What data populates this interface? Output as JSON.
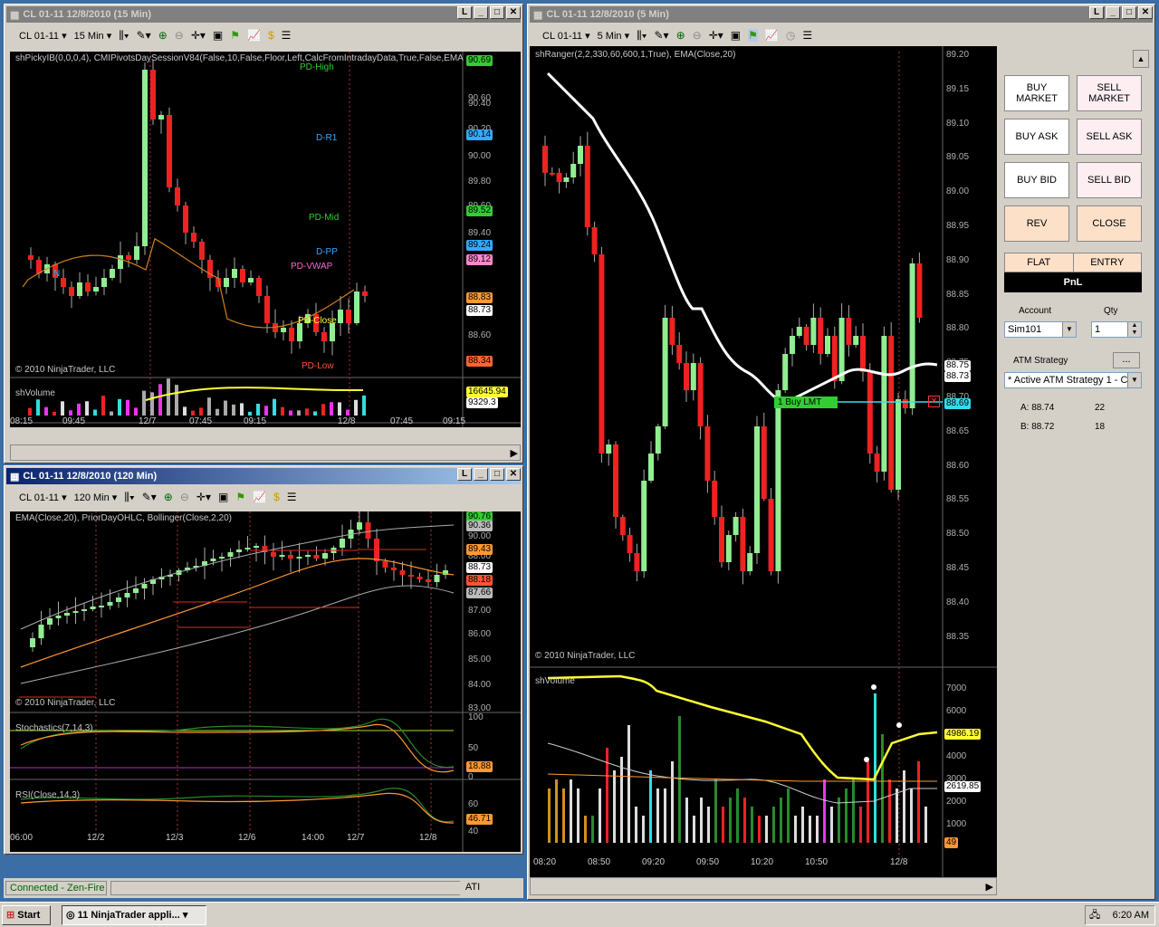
{
  "status_bar": {
    "connection": "Connected - Zen-Fire",
    "ati": "ATI"
  },
  "taskbar": {
    "start": "Start",
    "task": "11 NinjaTrader appli...",
    "time": "6:20 AM"
  },
  "win15": {
    "title": "CL 01-11  12/8/2010 (15 Min)",
    "instrument": "CL 01-11",
    "interval": "15 Min",
    "indicator_title": "shPickyIB(0,0,0,4),  CMIPivotsDaySessionV84(False,10,False,Floor,Left,CalcFromIntradayData,True,False,EMA",
    "copyright": "© 2010 NinjaTrader, LLC",
    "volume_title": "shVolume",
    "pivots": [
      {
        "name": "PD-High",
        "color": "#33cc33"
      },
      {
        "name": "D-R1",
        "color": "#33aaff"
      },
      {
        "name": "PD-Mid",
        "color": "#33cc33"
      },
      {
        "name": "D-PP",
        "color": "#33aaff"
      },
      {
        "name": "PD-VWAP",
        "color": "#ff66cc"
      },
      {
        "name": "PD-Close",
        "color": "#ffff33"
      },
      {
        "name": "PD-Low",
        "color": "#ff5533"
      },
      {
        "name": "N",
        "color": "#33aaff"
      }
    ],
    "price_ticks": [
      "90.60",
      "90.40",
      "90.20",
      "90.00",
      "89.80",
      "89.60",
      "89.40",
      "88.60",
      "88.40"
    ],
    "price_tags": [
      {
        "v": "90.69",
        "bg": "#33cc33"
      },
      {
        "v": "90.14",
        "bg": "#33aaff"
      },
      {
        "v": "89.52",
        "bg": "#33cc33"
      },
      {
        "v": "89.24",
        "bg": "#33aaff"
      },
      {
        "v": "89.12",
        "bg": "#ff88cc"
      },
      {
        "v": "88.83",
        "bg": "#ff9933"
      },
      {
        "v": "88.73",
        "bg": "#fff"
      },
      {
        "v": "88.34",
        "bg": "#ff6633"
      }
    ],
    "vol_tags": [
      {
        "v": "16645.94",
        "bg": "#ffff33"
      },
      {
        "v": "9329.3",
        "bg": "#fff"
      }
    ],
    "time_ticks": [
      "08:15",
      "09:45",
      "12/7",
      "07:45",
      "09:15",
      "12/8",
      "07:45",
      "09:15"
    ]
  },
  "win120": {
    "title": "CL 01-11  12/8/2010 (120 Min)",
    "instrument": "CL 01-11",
    "interval": "120 Min",
    "indicator_title": "EMA(Close,20), PriorDayOHLC, Bollinger(Close,2,20)",
    "copyright": "© 2010 NinjaTrader, LLC",
    "price_ticks": [
      "90.00",
      "88.00",
      "87.00",
      "86.00",
      "85.00",
      "84.00",
      "83.00"
    ],
    "price_tags": [
      {
        "v": "90.76",
        "bg": "#33cc33"
      },
      {
        "v": "90.36",
        "bg": "#bbb"
      },
      {
        "v": "89.43",
        "bg": "#ff9933"
      },
      {
        "v": "88.73",
        "bg": "#fff"
      },
      {
        "v": "88.18",
        "bg": "#ff5533"
      },
      {
        "v": "87.66",
        "bg": "#bbb"
      }
    ],
    "stoch_title": "Stochastics(7,14,3)",
    "stoch_ticks": [
      "100",
      "50",
      "0"
    ],
    "stoch_tag": "18.88",
    "rsi_title": "RSI(Close,14,3)",
    "rsi_ticks": [
      "60",
      "40"
    ],
    "rsi_tag": "46.71",
    "time_ticks": [
      "06:00",
      "12/2",
      "12/3",
      "12/6",
      "14:00",
      "12/7",
      "12/8"
    ]
  },
  "win5": {
    "title": "CL 01-11  12/8/2010 (5 Min)",
    "instrument": "CL 01-11",
    "interval": "5 Min",
    "indicator_title": "shRanger(2,2,330,60,600,1,True), EMA(Close,20)",
    "copyright": "© 2010 NinjaTrader, LLC",
    "volume_title": "shVolume",
    "price_ticks": [
      "89.20",
      "89.15",
      "89.10",
      "89.05",
      "89.00",
      "88.95",
      "88.90",
      "88.85",
      "88.80",
      "88.75",
      "88.70",
      "88.65",
      "88.60",
      "88.55",
      "88.50",
      "88.45",
      "88.40",
      "88.35"
    ],
    "price_tags": [
      {
        "v": "88.75",
        "bg": "#fff"
      },
      {
        "v": "88.73",
        "bg": "#fff"
      },
      {
        "v": "88.69",
        "bg": "#33ddee"
      }
    ],
    "order_label": "1  Buy LMT",
    "vol_ticks": [
      "7000",
      "6000",
      "5000",
      "4000",
      "3000",
      "2000",
      "1000"
    ],
    "vol_tags": [
      {
        "v": "4986.19",
        "bg": "#ffff33"
      },
      {
        "v": "2619.85",
        "bg": "#fff"
      },
      {
        "v": "49",
        "bg": "#ff9933"
      }
    ],
    "time_ticks": [
      "08:20",
      "08:50",
      "09:20",
      "09:50",
      "10:20",
      "10:50",
      "12/8"
    ]
  },
  "order_panel": {
    "buy_market": "BUY MARKET",
    "sell_market": "SELL MARKET",
    "buy_ask": "BUY ASK",
    "sell_ask": "SELL ASK",
    "buy_bid": "BUY BID",
    "sell_bid": "SELL BID",
    "rev": "REV",
    "close": "CLOSE",
    "flat": "FLAT",
    "entry": "ENTRY",
    "pnl": "PnL",
    "account_label": "Account",
    "qty_label": "Qty",
    "account": "Sim101",
    "qty": "1",
    "atm_label": "ATM Strategy",
    "atm_value": "* Active ATM Strategy 1 - C",
    "more": "...",
    "ask": "A: 88.74",
    "ask_size": "22",
    "bid": "B: 88.72",
    "bid_size": "18"
  }
}
